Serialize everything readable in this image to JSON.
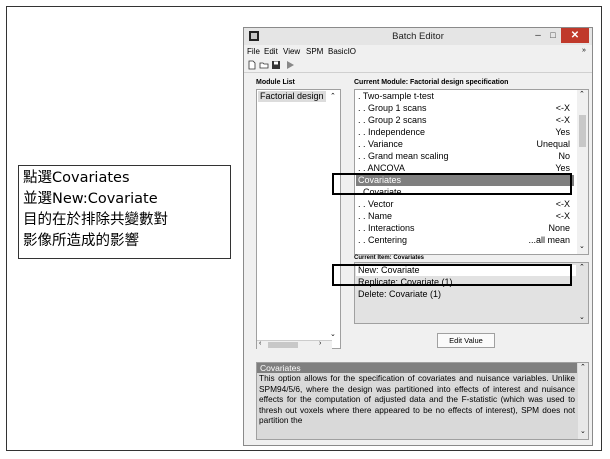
{
  "caption": {
    "lines": [
      "點選Covariates",
      "並選New:Covariate",
      "目的在於排除共變數對",
      "影像所造成的影響"
    ]
  },
  "window": {
    "title": "Batch Editor",
    "controls": {
      "minimize": "–",
      "maximize": "□",
      "close": "✕"
    }
  },
  "menubar": {
    "items": [
      "File",
      "Edit",
      "View",
      "SPM",
      "BasicIO"
    ],
    "overflow": "»"
  },
  "toolbar": {
    "new_icon": "new-file-icon",
    "open_icon": "open-folder-icon",
    "save_icon": "save-icon",
    "run_icon": "run-icon"
  },
  "module_list": {
    "label": "Module List",
    "items": [
      "Factorial design"
    ]
  },
  "current_module": {
    "label": "Current Module: Factorial design specification",
    "rows": [
      {
        "text": ". Two-sample t-test",
        "value": ""
      },
      {
        "text": ". . Group 1 scans",
        "value": "<-X"
      },
      {
        "text": ". . Group 2 scans",
        "value": "<-X"
      },
      {
        "text": ". . Independence",
        "value": "Yes"
      },
      {
        "text": ". . Variance",
        "value": "Unequal"
      },
      {
        "text": ". . Grand mean scaling",
        "value": "No"
      },
      {
        "text": ". . ANCOVA",
        "value": "Yes"
      },
      {
        "text": "Covariates",
        "value": ""
      },
      {
        "text": ". Covariate",
        "value": ""
      },
      {
        "text": ". . Vector",
        "value": "<-X"
      },
      {
        "text": ". . Name",
        "value": "<-X"
      },
      {
        "text": ". . Interactions",
        "value": "None"
      },
      {
        "text": ". . Centering",
        "value": "...all mean"
      }
    ],
    "selected_index": 7
  },
  "current_item": {
    "label": "Current Item: Covariates",
    "rows": [
      "New: Covariate",
      "Replicate: Covariate (1)",
      "Delete: Covariate (1)"
    ],
    "selected_index": 0
  },
  "edit_button": {
    "label": "Edit Value"
  },
  "help": {
    "title": "Covariates",
    "text": "This option allows for the specification of covariates and nuisance variables. Unlike SPM94/5/6, where the design was partitioned into effects of interest and nuisance effects for the computation of adjusted data and the F-statistic (which was used to thresh out voxels where there appeared to be no effects of interest), SPM does not partition the"
  },
  "colors": {
    "selection_bg": "#7f7f7f",
    "annotation_border": "#000000"
  }
}
